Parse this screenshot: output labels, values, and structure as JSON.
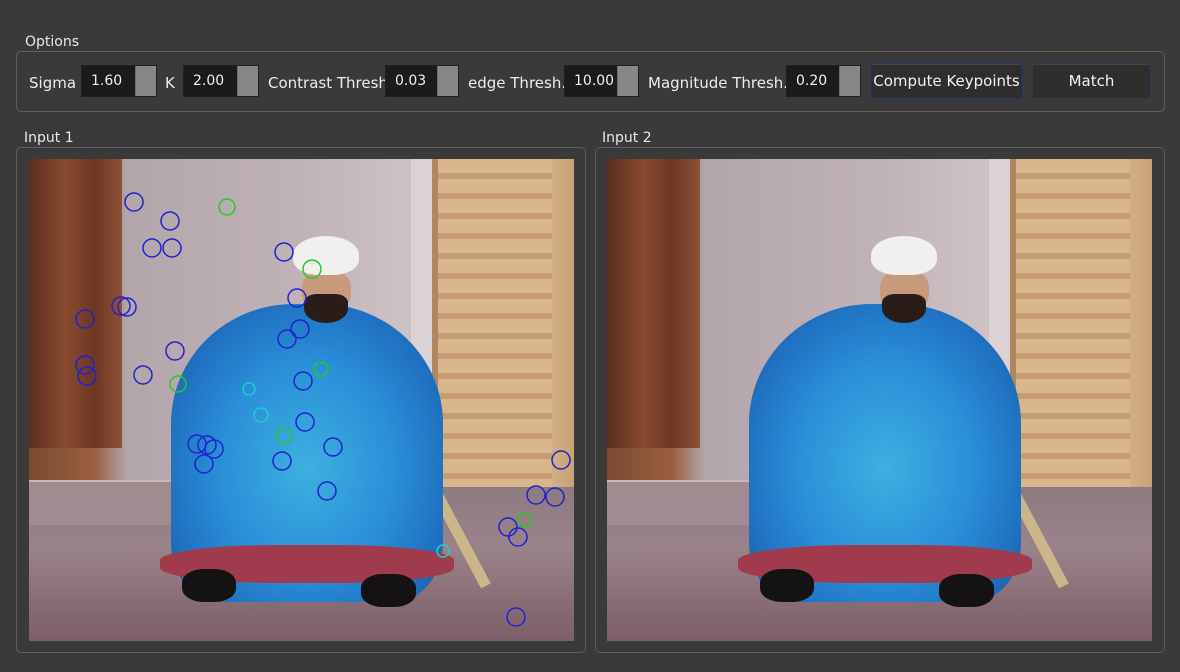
{
  "options": {
    "group_title": "Options",
    "sigma": {
      "label": "Sigma",
      "value": "1.60"
    },
    "k": {
      "label": "K",
      "value": "2.00"
    },
    "contrast": {
      "label": "Contrast Thresh",
      "value": "0.03"
    },
    "edge": {
      "label": "edge Thresh.",
      "value": "10.00"
    },
    "magnitude": {
      "label": "Magnitude Thresh.",
      "value": "0.20"
    },
    "compute_label": "Compute Keypoints",
    "match_label": "Match"
  },
  "input1": {
    "title": "Input 1"
  },
  "input2": {
    "title": "Input 2"
  },
  "colors": {
    "background": "#3a3a3a",
    "keypoint_blue": "#2222cc",
    "keypoint_green": "#22cc22",
    "keypoint_cyan": "#22cccc"
  }
}
